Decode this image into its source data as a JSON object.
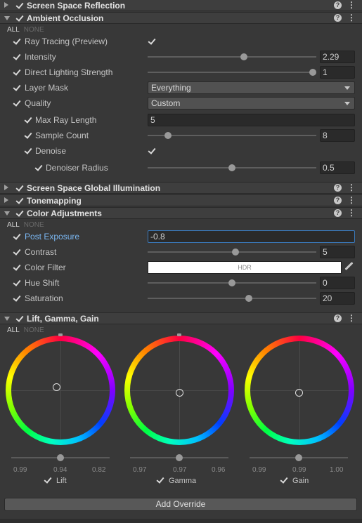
{
  "sections": {
    "ssr": {
      "title": "Screen Space Reflection",
      "icon": "collapsed-arrow"
    },
    "ao": {
      "title": "Ambient Occlusion"
    },
    "ssgi": {
      "title": "Screen Space Global Illumination"
    },
    "tonemapping": {
      "title": "Tonemapping"
    },
    "color_adjustments": {
      "title": "Color Adjustments"
    },
    "lgg": {
      "title": "Lift, Gamma, Gain"
    }
  },
  "toggle_all": {
    "all": "ALL",
    "none": "NONE"
  },
  "ao": {
    "ray_tracing": {
      "label": "Ray Tracing (Preview)",
      "checked": true
    },
    "intensity": {
      "label": "Intensity",
      "value": "2.29",
      "slider": 0.57
    },
    "direct_lighting": {
      "label": "Direct Lighting Strength",
      "value": "1",
      "slider": 1.0
    },
    "layer_mask": {
      "label": "Layer Mask",
      "value": "Everything"
    },
    "quality": {
      "label": "Quality",
      "value": "Custom"
    },
    "max_ray_length": {
      "label": "Max Ray Length",
      "value": "5"
    },
    "sample_count": {
      "label": "Sample Count",
      "value": "8",
      "slider": 0.12
    },
    "denoise": {
      "label": "Denoise",
      "checked": true
    },
    "denoiser_radius": {
      "label": "Denoiser Radius",
      "value": "0.5",
      "slider": 0.5
    }
  },
  "color_adjustments": {
    "post_exposure": {
      "label": "Post Exposure",
      "value": "-0.8"
    },
    "contrast": {
      "label": "Contrast",
      "value": "5",
      "slider": 0.52
    },
    "color_filter": {
      "label": "Color Filter",
      "value": "HDR",
      "color": "#ffffff"
    },
    "hue_shift": {
      "label": "Hue Shift",
      "value": "0",
      "slider": 0.5
    },
    "saturation": {
      "label": "Saturation",
      "value": "20",
      "slider": 0.6
    }
  },
  "lgg": {
    "wheels": [
      {
        "label": "Lift",
        "values": [
          "0.99",
          "0.94",
          "0.82"
        ]
      },
      {
        "label": "Gamma",
        "values": [
          "0.97",
          "0.97",
          "0.96"
        ]
      },
      {
        "label": "Gain",
        "values": [
          "0.99",
          "0.99",
          "1.00"
        ]
      }
    ]
  },
  "add_override": "Add Override",
  "colors": {
    "accent": "#3a79bb",
    "active_label": "#7ab6f0",
    "background": "#383838",
    "header": "#3e3e3e"
  }
}
